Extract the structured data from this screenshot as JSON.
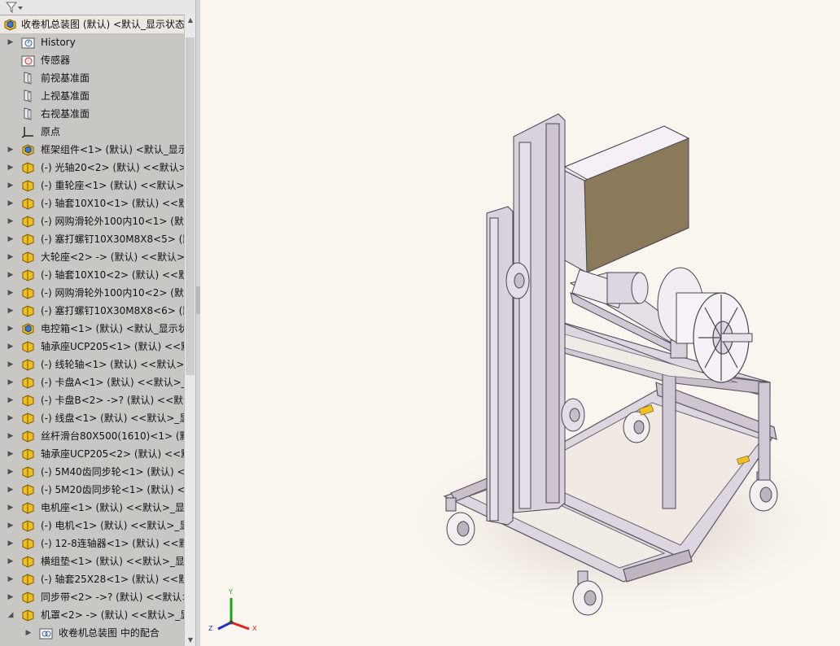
{
  "filter": {
    "icon": "filter-icon"
  },
  "tree": {
    "rows": [
      {
        "label": "收卷机总装图 (默认) <默认_显示状态",
        "icon": "assembly-icon",
        "expander": "none",
        "indent": 0,
        "root": true
      },
      {
        "label": "History",
        "icon": "history-folder-icon",
        "expander": "collapsed",
        "indent": 1
      },
      {
        "label": "传感器",
        "icon": "sensors-folder-icon",
        "expander": "none",
        "indent": 1
      },
      {
        "label": "前视基准面",
        "icon": "plane-icon",
        "expander": "none",
        "indent": 1
      },
      {
        "label": "上视基准面",
        "icon": "plane-icon",
        "expander": "none",
        "indent": 1
      },
      {
        "label": "右视基准面",
        "icon": "plane-icon",
        "expander": "none",
        "indent": 1
      },
      {
        "label": "原点",
        "icon": "origin-icon",
        "expander": "none",
        "indent": 1
      },
      {
        "label": "框架组件<1> (默认) <默认_显示",
        "icon": "subassembly-icon",
        "expander": "collapsed",
        "indent": 1
      },
      {
        "label": "(-) 光轴20<2> (默认) <<默认>_",
        "icon": "part-icon",
        "expander": "collapsed",
        "indent": 1
      },
      {
        "label": "(-) 重轮座<1> (默认) <<默认>_",
        "icon": "part-icon",
        "expander": "collapsed",
        "indent": 1
      },
      {
        "label": "(-) 轴套10X10<1> (默认) <<默",
        "icon": "part-icon",
        "expander": "collapsed",
        "indent": 1
      },
      {
        "label": "(-) 网购滑轮外100内10<1> (默认",
        "icon": "part-icon",
        "expander": "collapsed",
        "indent": 1
      },
      {
        "label": "(-) 塞打螺钉10X30M8X8<5> (默",
        "icon": "part-icon",
        "expander": "collapsed",
        "indent": 1
      },
      {
        "label": "大轮座<2> -> (默认) <<默认>_",
        "icon": "part-icon",
        "expander": "collapsed",
        "indent": 1
      },
      {
        "label": "(-) 轴套10X10<2> (默认) <<默认",
        "icon": "part-icon",
        "expander": "collapsed",
        "indent": 1
      },
      {
        "label": "(-) 网购滑轮外100内10<2> (默认",
        "icon": "part-icon",
        "expander": "collapsed",
        "indent": 1
      },
      {
        "label": "(-) 塞打螺钉10X30M8X8<6> (默",
        "icon": "part-icon",
        "expander": "collapsed",
        "indent": 1
      },
      {
        "label": "电控箱<1> (默认) <默认_显示状",
        "icon": "subassembly-icon",
        "expander": "collapsed",
        "indent": 1
      },
      {
        "label": "轴承座UCP205<1> (默认) <<默认",
        "icon": "part-icon",
        "expander": "collapsed",
        "indent": 1
      },
      {
        "label": "(-) 线轮轴<1> (默认) <<默认>_",
        "icon": "part-icon",
        "expander": "collapsed",
        "indent": 1
      },
      {
        "label": "(-) 卡盘A<1> (默认) <<默认>_显",
        "icon": "part-icon",
        "expander": "collapsed",
        "indent": 1
      },
      {
        "label": "(-) 卡盘B<2> ->? (默认) <<默认",
        "icon": "part-icon",
        "expander": "collapsed",
        "indent": 1
      },
      {
        "label": "(-) 线盘<1> (默认) <<默认>_显",
        "icon": "part-icon",
        "expander": "collapsed",
        "indent": 1
      },
      {
        "label": "丝杆滑台80X500(1610)<1> (默认",
        "icon": "part-icon",
        "expander": "collapsed",
        "indent": 1
      },
      {
        "label": "轴承座UCP205<2> (默认) <<默认",
        "icon": "part-icon",
        "expander": "collapsed",
        "indent": 1
      },
      {
        "label": "(-) 5M40齿同步轮<1> (默认) <",
        "icon": "part-icon",
        "expander": "collapsed",
        "indent": 1
      },
      {
        "label": "(-) 5M20齿同步轮<1> (默认) <",
        "icon": "part-icon",
        "expander": "collapsed",
        "indent": 1
      },
      {
        "label": "电机座<1> (默认) <<默认>_显示",
        "icon": "part-icon",
        "expander": "collapsed",
        "indent": 1
      },
      {
        "label": "(-) 电机<1> (默认) <<默认>_显",
        "icon": "part-icon",
        "expander": "collapsed",
        "indent": 1
      },
      {
        "label": "(-) 12-8连轴器<1> (默认) <<默认",
        "icon": "part-icon",
        "expander": "collapsed",
        "indent": 1
      },
      {
        "label": "横组垫<1> (默认) <<默认>_显示",
        "icon": "part-icon",
        "expander": "collapsed",
        "indent": 1
      },
      {
        "label": "(-) 轴套25X28<1> (默认) <<默认",
        "icon": "part-icon",
        "expander": "collapsed",
        "indent": 1
      },
      {
        "label": "同步带<2> ->? (默认) <<默认>_",
        "icon": "part-icon",
        "expander": "collapsed",
        "indent": 1
      },
      {
        "label": "机罩<2> -> (默认) <<默认>_显",
        "icon": "part-icon",
        "expander": "expanded",
        "indent": 1
      },
      {
        "label": "收卷机总装图 中的配合",
        "icon": "mates-folder-icon",
        "expander": "collapsed",
        "indent": 2
      }
    ]
  },
  "viewport": {
    "triad": {
      "x_label": "X",
      "y_label": "Y",
      "z_label": "Z"
    }
  },
  "colors": {
    "panel_bg": "#c9c7c4",
    "viewport_bg": "#fbf5f0",
    "frame": "#d9d2dc",
    "cabinet_panel": "#8a7a5a",
    "part_yellow": "#f0c020"
  }
}
